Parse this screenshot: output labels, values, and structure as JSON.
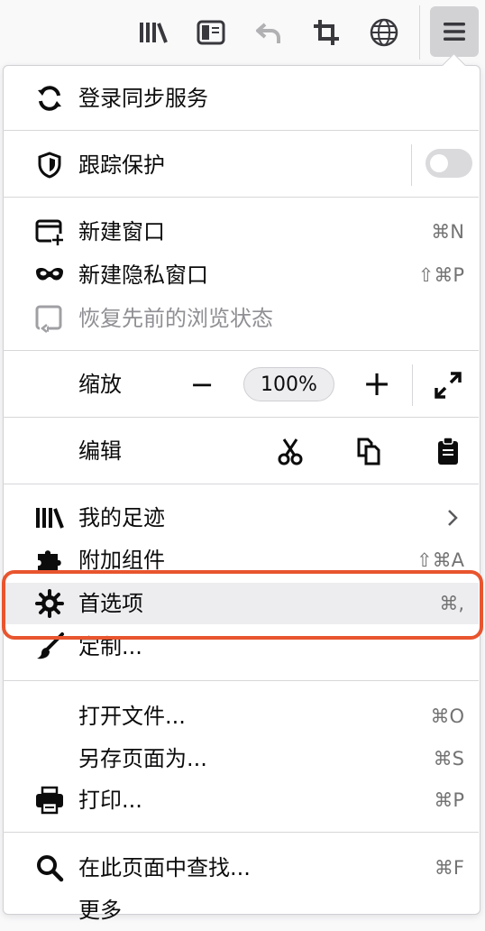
{
  "toolbar": {
    "buttons": [
      "library-icon",
      "sidebar-icon",
      "undo-icon",
      "crop-icon",
      "globe-icon",
      "hamburger-menu-icon"
    ]
  },
  "menu": {
    "sync": "登录同步服务",
    "tracking": "跟踪保护",
    "new_window": "新建窗口",
    "new_window_sc": "⌘N",
    "private_window": "新建隐私窗口",
    "private_window_sc": "⇧⌘P",
    "restore": "恢复先前的浏览状态",
    "zoom": "缩放",
    "zoom_value": "100%",
    "zoom_minus": "−",
    "zoom_plus": "+",
    "edit": "编辑",
    "library": "我的足迹",
    "addons": "附加组件",
    "addons_sc": "⇧⌘A",
    "prefs": "首选项",
    "prefs_sc": "⌘,",
    "customize": "定制...",
    "open_file": "打开文件...",
    "open_file_sc": "⌘O",
    "save_page": "另存页面为...",
    "save_page_sc": "⌘S",
    "print": "打印...",
    "print_sc": "⌘P",
    "find": "在此页面中查找...",
    "find_sc": "⌘F",
    "more": "更多"
  },
  "colors": {
    "highlight_border": "#e8552f",
    "hover_bg": "#ededf0",
    "toggle_off": "#dadadd"
  }
}
